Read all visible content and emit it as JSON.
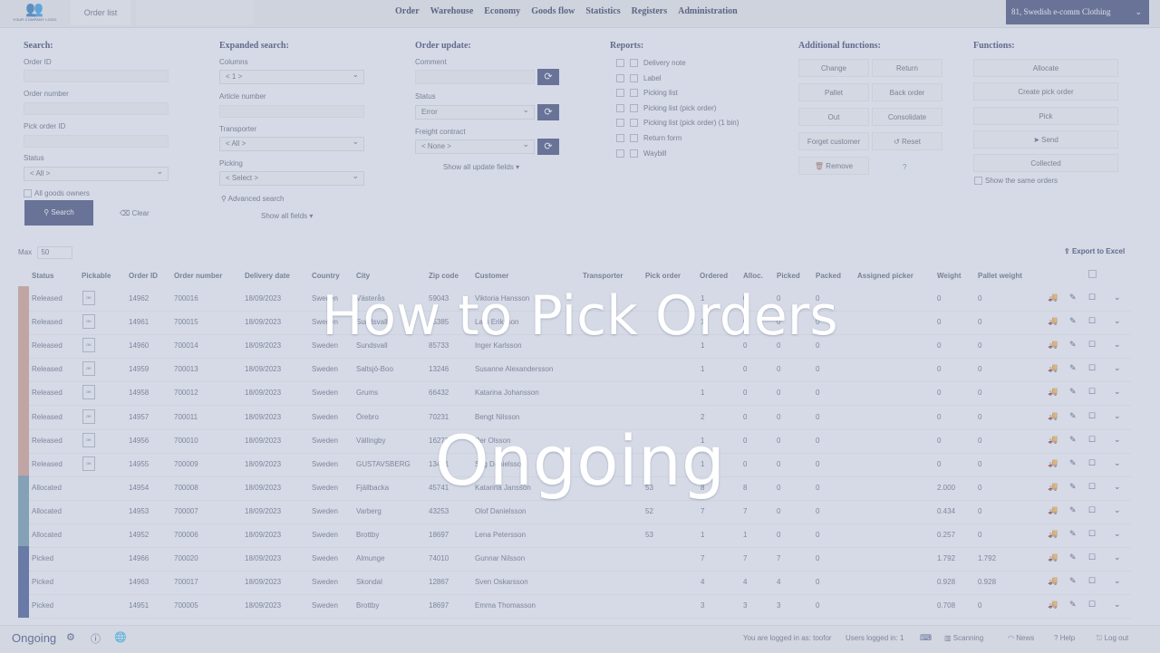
{
  "topbar": {
    "logo_caption": "YOUR COMPANY LOGO",
    "active_tab": "Order list",
    "nav": [
      "Order",
      "Warehouse",
      "Economy",
      "Goods flow",
      "Statistics",
      "Registers",
      "Administration"
    ],
    "company": "81, Swedish e-comm Clothing"
  },
  "search": {
    "title": "Search:",
    "order_id_label": "Order ID",
    "order_number_label": "Order number",
    "pick_order_id_label": "Pick order ID",
    "status_label": "Status",
    "status_value": "< All >",
    "all_goods_owners": "All goods owners",
    "search_button": "Search",
    "clear_button": "Clear"
  },
  "expanded": {
    "title": "Expanded search:",
    "columns_label": "Columns",
    "columns_value": "< 1 >",
    "article_label": "Article number",
    "transporter_label": "Transporter",
    "transporter_value": "< All >",
    "picking_label": "Picking",
    "picking_value": "< Select >",
    "advanced": "Advanced search",
    "show_all": "Show all fields"
  },
  "update": {
    "title": "Order update:",
    "comment_label": "Comment",
    "status_label": "Status",
    "status_value": "Error",
    "freight_label": "Freight contract",
    "freight_value": "< None >",
    "show_all": "Show all update fields"
  },
  "reports": {
    "title": "Reports:",
    "items": [
      "Delivery note",
      "Label",
      "Picking list",
      "Picking list (pick order)",
      "Picking list (pick order) (1 bin)",
      "Return form",
      "Waybill"
    ]
  },
  "additional": {
    "title": "Additional functions:",
    "buttons": [
      "Change",
      "Return",
      "Pallet",
      "Back order",
      "Out",
      "Consolidate",
      "Forget customer",
      "Reset",
      "Remove"
    ]
  },
  "functions": {
    "title": "Functions:",
    "buttons": [
      "Allocate",
      "Create pick order",
      "Pick",
      "Send",
      "Collected"
    ],
    "show_same": "Show the same orders"
  },
  "paging": {
    "label": "Max",
    "value": "50"
  },
  "export": "Export to Excel",
  "columns": [
    "Status",
    "Pickable",
    "Order ID",
    "Order number",
    "Delivery date",
    "Country",
    "City",
    "Zip code",
    "Customer",
    "Transporter",
    "Pick order",
    "Ordered",
    "Alloc.",
    "Picked",
    "Packed",
    "Assigned picker",
    "Weight",
    "Pallet weight"
  ],
  "status_colors": {
    "Released": "#c98e86",
    "Allocated": "#5b8fb0",
    "Picked": "#3a56a8"
  },
  "rows": [
    {
      "status": "Released",
      "ok": "OK",
      "id": "14962",
      "num": "700016",
      "date": "18/09/2023",
      "country": "Sweden",
      "city": "Västerås",
      "zip": "59043",
      "customer": "Viktoria Hansson",
      "pick": "",
      "ordered": "1",
      "alloc": "0",
      "picked": "0",
      "packed": "0",
      "weight": "0",
      "pweight": "0"
    },
    {
      "status": "Released",
      "ok": "OK",
      "id": "14961",
      "num": "700015",
      "date": "18/09/2023",
      "country": "Sweden",
      "city": "Sundsvall",
      "zip": "85385",
      "customer": "Lars Eriksson",
      "pick": "",
      "ordered": "1",
      "alloc": "0",
      "picked": "0",
      "packed": "0",
      "weight": "0",
      "pweight": "0"
    },
    {
      "status": "Released",
      "ok": "OK",
      "id": "14960",
      "num": "700014",
      "date": "18/09/2023",
      "country": "Sweden",
      "city": "Sundsvall",
      "zip": "85733",
      "customer": "Inger Karlsson",
      "pick": "",
      "ordered": "1",
      "alloc": "0",
      "picked": "0",
      "packed": "0",
      "weight": "0",
      "pweight": "0"
    },
    {
      "status": "Released",
      "ok": "OK",
      "id": "14959",
      "num": "700013",
      "date": "18/09/2023",
      "country": "Sweden",
      "city": "Saltsjö-Boo",
      "zip": "13246",
      "customer": "Susanne Alexandersson",
      "pick": "",
      "ordered": "1",
      "alloc": "0",
      "picked": "0",
      "packed": "0",
      "weight": "0",
      "pweight": "0"
    },
    {
      "status": "Released",
      "ok": "OK",
      "id": "14958",
      "num": "700012",
      "date": "18/09/2023",
      "country": "Sweden",
      "city": "Grums",
      "zip": "66432",
      "customer": "Katarina Johansson",
      "pick": "",
      "ordered": "1",
      "alloc": "0",
      "picked": "0",
      "packed": "0",
      "weight": "0",
      "pweight": "0"
    },
    {
      "status": "Released",
      "ok": "OK",
      "id": "14957",
      "num": "700011",
      "date": "18/09/2023",
      "country": "Sweden",
      "city": "Örebro",
      "zip": "70231",
      "customer": "Bengt Nilsson",
      "pick": "",
      "ordered": "2",
      "alloc": "0",
      "picked": "0",
      "packed": "0",
      "weight": "0",
      "pweight": "0"
    },
    {
      "status": "Released",
      "ok": "OK",
      "id": "14956",
      "num": "700010",
      "date": "18/09/2023",
      "country": "Sweden",
      "city": "Vällingby",
      "zip": "16271",
      "customer": "Per Olsson",
      "pick": "",
      "ordered": "1",
      "alloc": "0",
      "picked": "0",
      "packed": "0",
      "weight": "0",
      "pweight": "0"
    },
    {
      "status": "Released",
      "ok": "OK",
      "id": "14955",
      "num": "700009",
      "date": "18/09/2023",
      "country": "Sweden",
      "city": "GUSTAVSBERG",
      "zip": "13431",
      "customer": "Stig Danielsson",
      "pick": "",
      "ordered": "1",
      "alloc": "0",
      "picked": "0",
      "packed": "0",
      "weight": "0",
      "pweight": "0"
    },
    {
      "status": "Allocated",
      "ok": "",
      "id": "14954",
      "num": "700008",
      "date": "18/09/2023",
      "country": "Sweden",
      "city": "Fjällbacka",
      "zip": "45741",
      "customer": "Katarina Jansson",
      "pick": "53",
      "ordered": "8",
      "alloc": "8",
      "picked": "0",
      "packed": "0",
      "weight": "2.000",
      "pweight": "0"
    },
    {
      "status": "Allocated",
      "ok": "",
      "id": "14953",
      "num": "700007",
      "date": "18/09/2023",
      "country": "Sweden",
      "city": "Varberg",
      "zip": "43253",
      "customer": "Olof Danielsson",
      "pick": "52",
      "ordered": "7",
      "alloc": "7",
      "picked": "0",
      "packed": "0",
      "weight": "0.434",
      "pweight": "0"
    },
    {
      "status": "Allocated",
      "ok": "",
      "id": "14952",
      "num": "700006",
      "date": "18/09/2023",
      "country": "Sweden",
      "city": "Brottby",
      "zip": "18697",
      "customer": "Lena Petersson",
      "pick": "53",
      "ordered": "1",
      "alloc": "1",
      "picked": "0",
      "packed": "0",
      "weight": "0.257",
      "pweight": "0"
    },
    {
      "status": "Picked",
      "ok": "",
      "id": "14966",
      "num": "700020",
      "date": "18/09/2023",
      "country": "Sweden",
      "city": "Almunge",
      "zip": "74010",
      "customer": "Gunnar Nilsson",
      "pick": "",
      "ordered": "7",
      "alloc": "7",
      "picked": "7",
      "packed": "0",
      "weight": "1.792",
      "pweight": "1.792"
    },
    {
      "status": "Picked",
      "ok": "",
      "id": "14963",
      "num": "700017",
      "date": "18/09/2023",
      "country": "Sweden",
      "city": "Skondal",
      "zip": "12867",
      "customer": "Sven Oskarsson",
      "pick": "",
      "ordered": "4",
      "alloc": "4",
      "picked": "4",
      "packed": "0",
      "weight": "0.928",
      "pweight": "0.928"
    },
    {
      "status": "Picked",
      "ok": "",
      "id": "14951",
      "num": "700005",
      "date": "18/09/2023",
      "country": "Sweden",
      "city": "Brottby",
      "zip": "18697",
      "customer": "Emma Thomasson",
      "pick": "",
      "ordered": "3",
      "alloc": "3",
      "picked": "3",
      "packed": "0",
      "weight": "0.708",
      "pweight": "0"
    }
  ],
  "footer": {
    "brand": "Ongoing",
    "logged_in": "You are logged in as: toofor",
    "users": "Users logged in: 1",
    "scanning": "Scanning",
    "news": "News",
    "help": "Help",
    "logout": "Log out"
  },
  "overlay": {
    "line1": "How to Pick Orders",
    "line2": "Ongoing"
  }
}
